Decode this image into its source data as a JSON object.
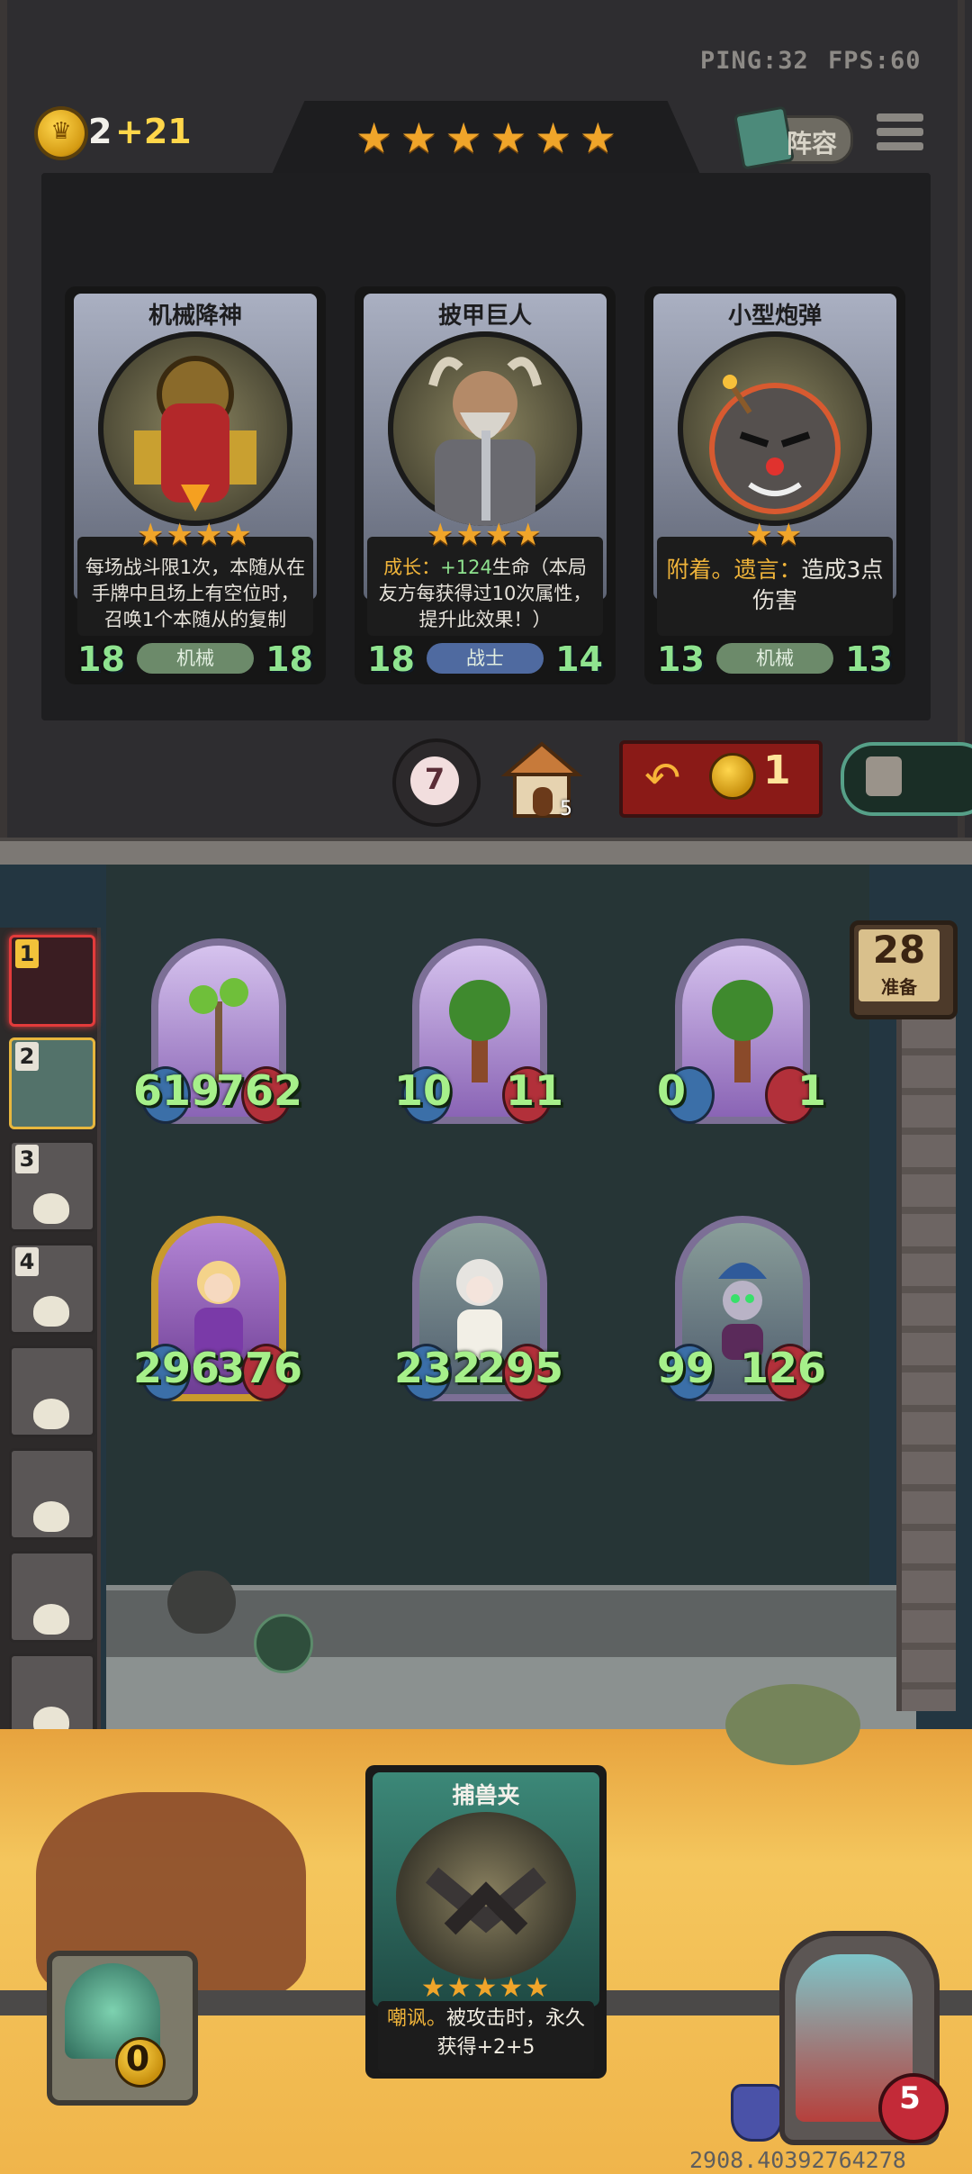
{
  "network": {
    "ping": "PING:32",
    "fps": "FPS:60"
  },
  "economy": {
    "gold": "2",
    "gold_income": "+21"
  },
  "tavern": {
    "tier_stars": 6,
    "lineup_label": "阵容"
  },
  "shop_cards": [
    {
      "name": "机械降神",
      "stars": "★★★★",
      "text": "每场战斗限1次，本随从在手牌中且场上有空位时，召唤1个本随从的复制",
      "attack": "18",
      "health": "18",
      "tribe": "机械"
    },
    {
      "name": "披甲巨人",
      "stars": "★★★★",
      "text_prefix": "成长：",
      "text_value": "+124",
      "text_rest": "生命（本局友方每获得过10次属性，提升此效果！）",
      "attack": "18",
      "health": "14",
      "tribe": "战士"
    },
    {
      "name": "小型炮弹",
      "stars": "★★",
      "text_keyword": "附着。遗言：",
      "text_rest": "造成3点伤害",
      "attack": "13",
      "health": "13",
      "tribe": "机械"
    }
  ],
  "shop_controls": {
    "refresh_tokens": "7",
    "house_count": "5",
    "refresh_cost": "1"
  },
  "turn": {
    "number": "28",
    "label": "准备"
  },
  "players": [
    {
      "rank": "1",
      "state": "active"
    },
    {
      "rank": "2",
      "state": "me"
    },
    {
      "rank": "3",
      "state": "dead"
    },
    {
      "rank": "4",
      "state": "dead"
    },
    {
      "rank": "",
      "state": "dead"
    },
    {
      "rank": "",
      "state": "dead"
    },
    {
      "rank": "",
      "state": "dead"
    },
    {
      "rank": "",
      "state": "dead"
    }
  ],
  "board": {
    "back_row": [
      {
        "attack": "619",
        "health": "762"
      },
      {
        "attack": "10",
        "health": "11"
      },
      {
        "attack": "0",
        "health": "1"
      }
    ],
    "front_row": [
      {
        "attack": "296",
        "health": "376"
      },
      {
        "attack": "232",
        "health": "295"
      },
      {
        "attack": "99",
        "health": "126"
      }
    ]
  },
  "hand_card": {
    "name": "捕兽夹",
    "stars": "★★★★★",
    "text_keyword": "嘲讽。",
    "text_rest": "被攻击时，永久获得+2+5"
  },
  "hero": {
    "power_cost": "0",
    "health": "5"
  },
  "debug": {
    "coords": "2908.40392764278"
  },
  "colors": {
    "stat_green": "#8fe38f",
    "star_orange": "#f0a52a",
    "gold_yellow": "#ffd64a",
    "keyword_orange": "#f0b43a"
  }
}
